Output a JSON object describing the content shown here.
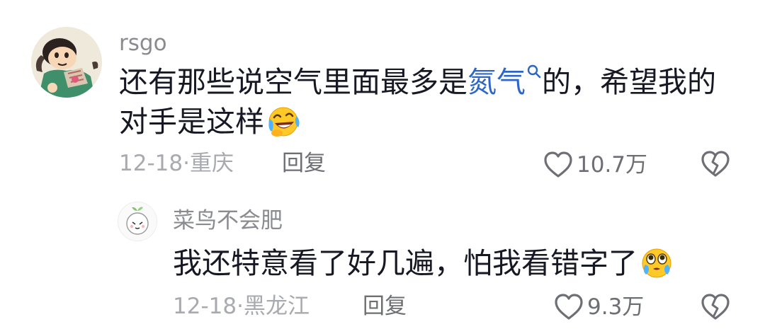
{
  "comment": {
    "username": "rsgo",
    "text_line1_part1": "还有那些说空气里面最多是",
    "text_highlight": "氮气",
    "text_line1_part2": "的，希望我的",
    "text_line2": "对手是这样",
    "date": "12-18",
    "location": "重庆",
    "reply_label": "回复",
    "likes": "10.7万",
    "emoji": "laughing-crying-emoji",
    "highlight_color": "#2e66c7"
  },
  "reply": {
    "username": "菜鸟不会肥",
    "text": "我还特意看了好几遍，怕我看错字了",
    "date": "12-18",
    "location": "黑龙江",
    "reply_label": "回复",
    "likes": "9.3万",
    "emoji": "teary-eyed-emoji"
  },
  "separator": "·"
}
